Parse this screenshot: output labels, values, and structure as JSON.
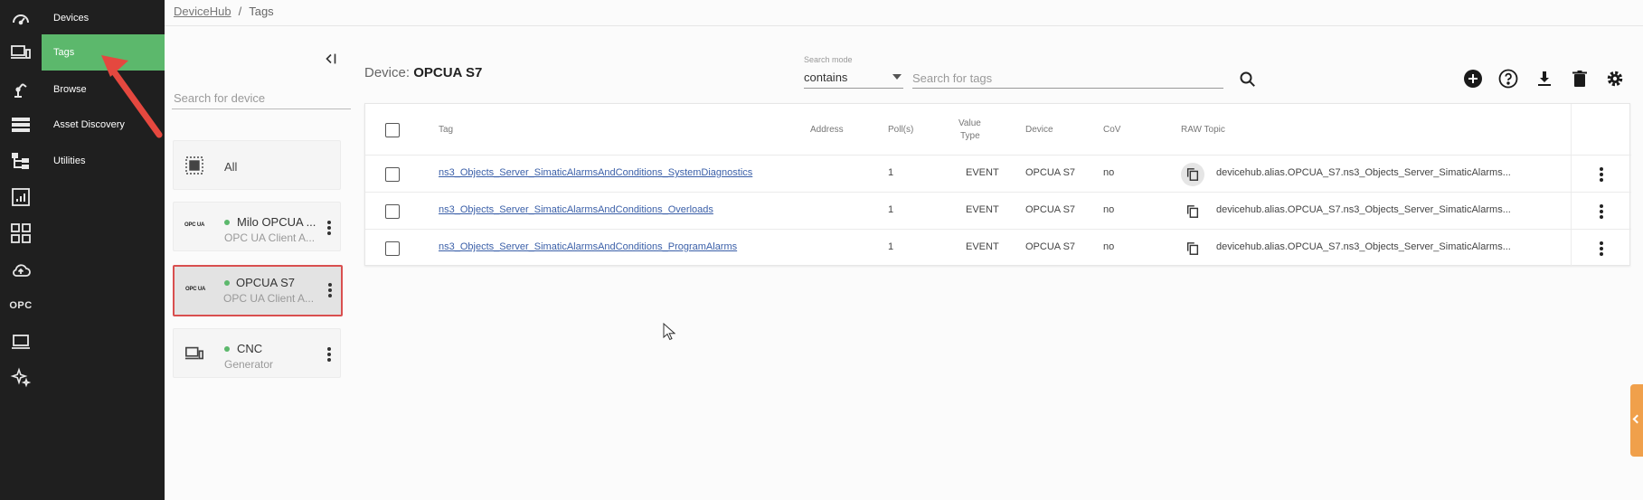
{
  "nav": {
    "items": [
      {
        "label": "Devices",
        "icon": "gauge-icon",
        "active": false
      },
      {
        "label": "Tags",
        "icon": "devices-icon",
        "active": true
      },
      {
        "label": "Browse",
        "icon": "robot-arm-icon",
        "active": false
      },
      {
        "label": "Asset Discovery",
        "icon": "server-list-icon",
        "active": false
      },
      {
        "label": "Utilities",
        "icon": "hierarchy-icon",
        "active": false
      }
    ],
    "extra_rail_icons": [
      "bar-chart-icon",
      "grid-icon",
      "cloud-upload-icon",
      "opc-icon",
      "laptop-icon",
      "sparkle-icon"
    ],
    "opc_label": "OPC",
    "active_color": "#5cb86c"
  },
  "breadcrumb": {
    "root": "DeviceHub",
    "separator": "/",
    "current": "Tags"
  },
  "device_panel": {
    "search_placeholder": "Search for device",
    "all_label": "All",
    "devices": [
      {
        "name": "Milo OPCUA ...",
        "type": "OPC UA Client A...",
        "logo": "OPC UA",
        "status_color": "#5cb86c",
        "selected": false
      },
      {
        "name": "OPCUA S7",
        "type": "OPC UA Client A...",
        "logo": "OPC UA",
        "status_color": "#5cb86c",
        "selected": true
      },
      {
        "name": "CNC",
        "type": "Generator",
        "logo": "",
        "status_color": "#5cb86c",
        "selected": false
      }
    ]
  },
  "content": {
    "device_prefix": "Device:",
    "device_name": "OPCUA S7",
    "search_mode_label": "Search mode",
    "search_mode_value": "contains",
    "tag_search_placeholder": "Search for tags",
    "toolbar_icons": [
      "add-circle-icon",
      "help-circle-icon",
      "download-icon",
      "delete-icon",
      "settings-icon"
    ]
  },
  "table": {
    "headers": {
      "tag": "Tag",
      "address": "Address",
      "poll": "Poll(s)",
      "value_type_1": "Value",
      "value_type_2": "Type",
      "device": "Device",
      "cov": "CoV",
      "raw_topic": "RAW Topic"
    },
    "rows": [
      {
        "tag": "ns3_Objects_Server_SimaticAlarmsAndConditions_SystemDiagnostics",
        "address": "",
        "poll": "1",
        "value_type": "EVENT",
        "device": "OPCUA S7",
        "cov": "no",
        "raw_topic": "devicehub.alias.OPCUA_S7.ns3_Objects_Server_SimaticAlarms..."
      },
      {
        "tag": "ns3_Objects_Server_SimaticAlarmsAndConditions_Overloads",
        "address": "",
        "poll": "1",
        "value_type": "EVENT",
        "device": "OPCUA S7",
        "cov": "no",
        "raw_topic": "devicehub.alias.OPCUA_S7.ns3_Objects_Server_SimaticAlarms..."
      },
      {
        "tag": "ns3_Objects_Server_SimaticAlarmsAndConditions_ProgramAlarms",
        "address": "",
        "poll": "1",
        "value_type": "EVENT",
        "device": "OPCUA S7",
        "cov": "no",
        "raw_topic": "devicehub.alias.OPCUA_S7.ns3_Objects_Server_SimaticAlarms..."
      }
    ]
  },
  "colors": {
    "sidebar_bg": "#1f1f1f",
    "accent_green": "#5cb86c",
    "selection_outline": "#d94f4f",
    "annotation_arrow": "#e5483f",
    "side_tab": "#f0a04b",
    "link": "#3a5fa8"
  }
}
